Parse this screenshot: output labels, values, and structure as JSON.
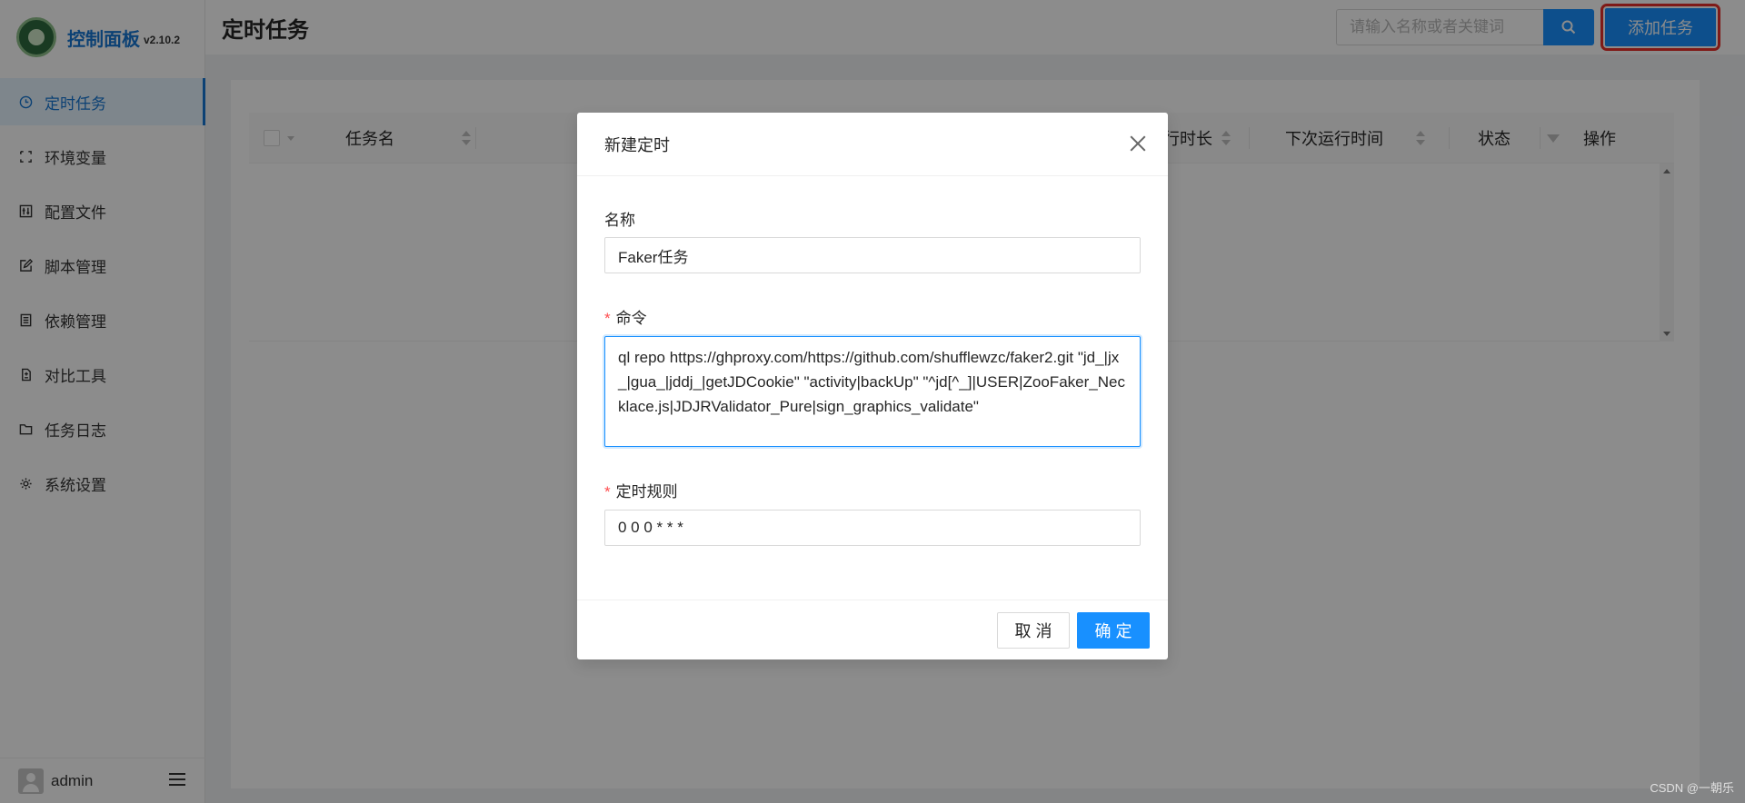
{
  "app": {
    "title": "控制面板",
    "version": "v2.10.2"
  },
  "sidebar": {
    "items": [
      {
        "label": "定时任务",
        "icon": "clock-icon"
      },
      {
        "label": "环境变量",
        "icon": "variable-icon"
      },
      {
        "label": "配置文件",
        "icon": "control-icon"
      },
      {
        "label": "脚本管理",
        "icon": "edit-icon"
      },
      {
        "label": "依赖管理",
        "icon": "container-icon"
      },
      {
        "label": "对比工具",
        "icon": "diff-icon"
      },
      {
        "label": "任务日志",
        "icon": "folder-icon"
      },
      {
        "label": "系统设置",
        "icon": "setting-icon"
      }
    ],
    "active_index": 0,
    "user": "admin"
  },
  "header": {
    "title": "定时任务",
    "search_placeholder": "请输入名称或者关键词",
    "add_button": "添加任务"
  },
  "table": {
    "columns": [
      "任务名",
      "行时长",
      "下次运行时间",
      "状态",
      "操作"
    ]
  },
  "modal": {
    "title": "新建定时",
    "name_label": "名称",
    "name_value": "Faker任务",
    "command_label": "命令",
    "command_value": "ql repo https://ghproxy.com/https://github.com/shufflewzc/faker2.git \"jd_|jx_|gua_|jddj_|getJDCookie\" \"activity|backUp\" \"^jd[^_]|USER|ZooFaker_Necklace.js|JDJRValidator_Pure|sign_graphics_validate\"",
    "schedule_label": "定时规则",
    "schedule_value": "0 0 0 * * *",
    "cancel_button": "取 消",
    "ok_button": "确 定"
  },
  "watermark": "CSDN @一朝乐",
  "colors": {
    "primary": "#1890ff",
    "highlight_border": "#e8302a",
    "required": "#ff4d4f"
  }
}
